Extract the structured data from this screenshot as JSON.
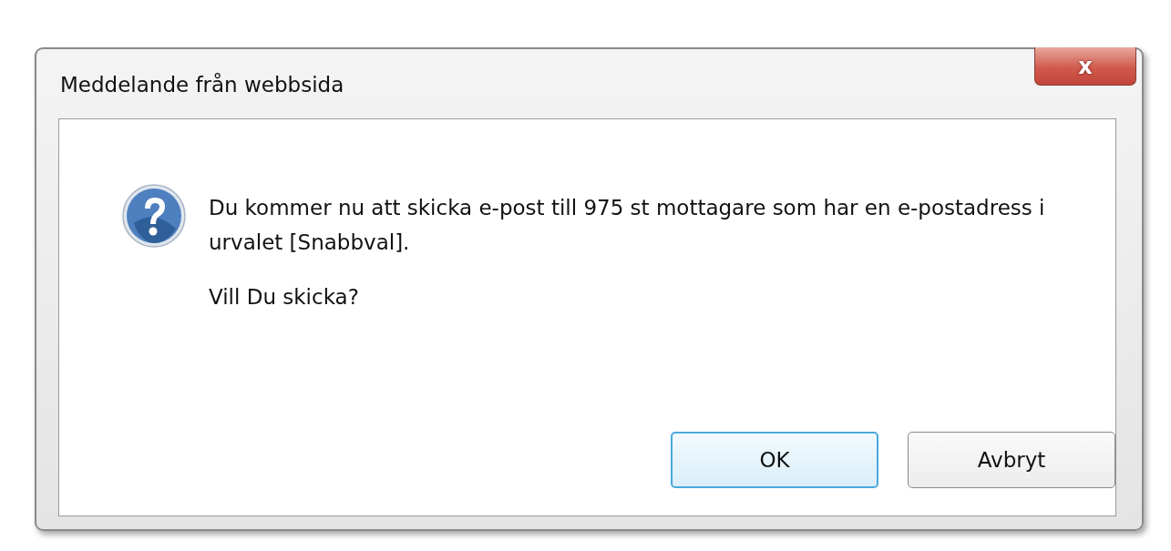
{
  "window": {
    "title": "Meddelande från webbsida",
    "close": "x"
  },
  "message": {
    "text": "Du kommer nu att skicka e-post till 975 st mottagare som har en e-postadress i urvalet [Snabbval].",
    "question": "Vill Du skicka?"
  },
  "buttons": [
    {
      "label": "OK",
      "default": true
    },
    {
      "label": "Avbryt",
      "default": false
    }
  ]
}
